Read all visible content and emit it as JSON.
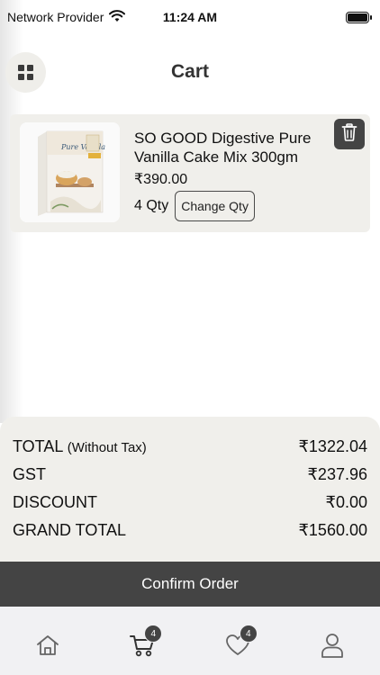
{
  "status_bar": {
    "carrier": "Network Provider",
    "time": "11:24 AM"
  },
  "header": {
    "title": "Cart"
  },
  "cart_items": [
    {
      "name": "SO GOOD Digestive Pure Vanilla Cake Mix 300gm",
      "price": "₹390.00",
      "qty": "4 Qty",
      "change_qty_label": "Change Qty"
    }
  ],
  "summary": {
    "total_label": "TOTAL",
    "total_note": "(Without Tax)",
    "total_value": "₹1322.04",
    "gst_label": "GST",
    "gst_value": "₹237.96",
    "discount_label": "DISCOUNT",
    "discount_value": "₹0.00",
    "grand_total_label": "GRAND TOTAL",
    "grand_total_value": "₹1560.00"
  },
  "confirm_button": {
    "label": "Confirm Order"
  },
  "bottom_nav": {
    "cart_badge": "4",
    "wishlist_badge": "4"
  },
  "colors": {
    "accent_dark": "#444444",
    "card_background": "#f0efeb",
    "nav_background": "#f1f1f3"
  }
}
